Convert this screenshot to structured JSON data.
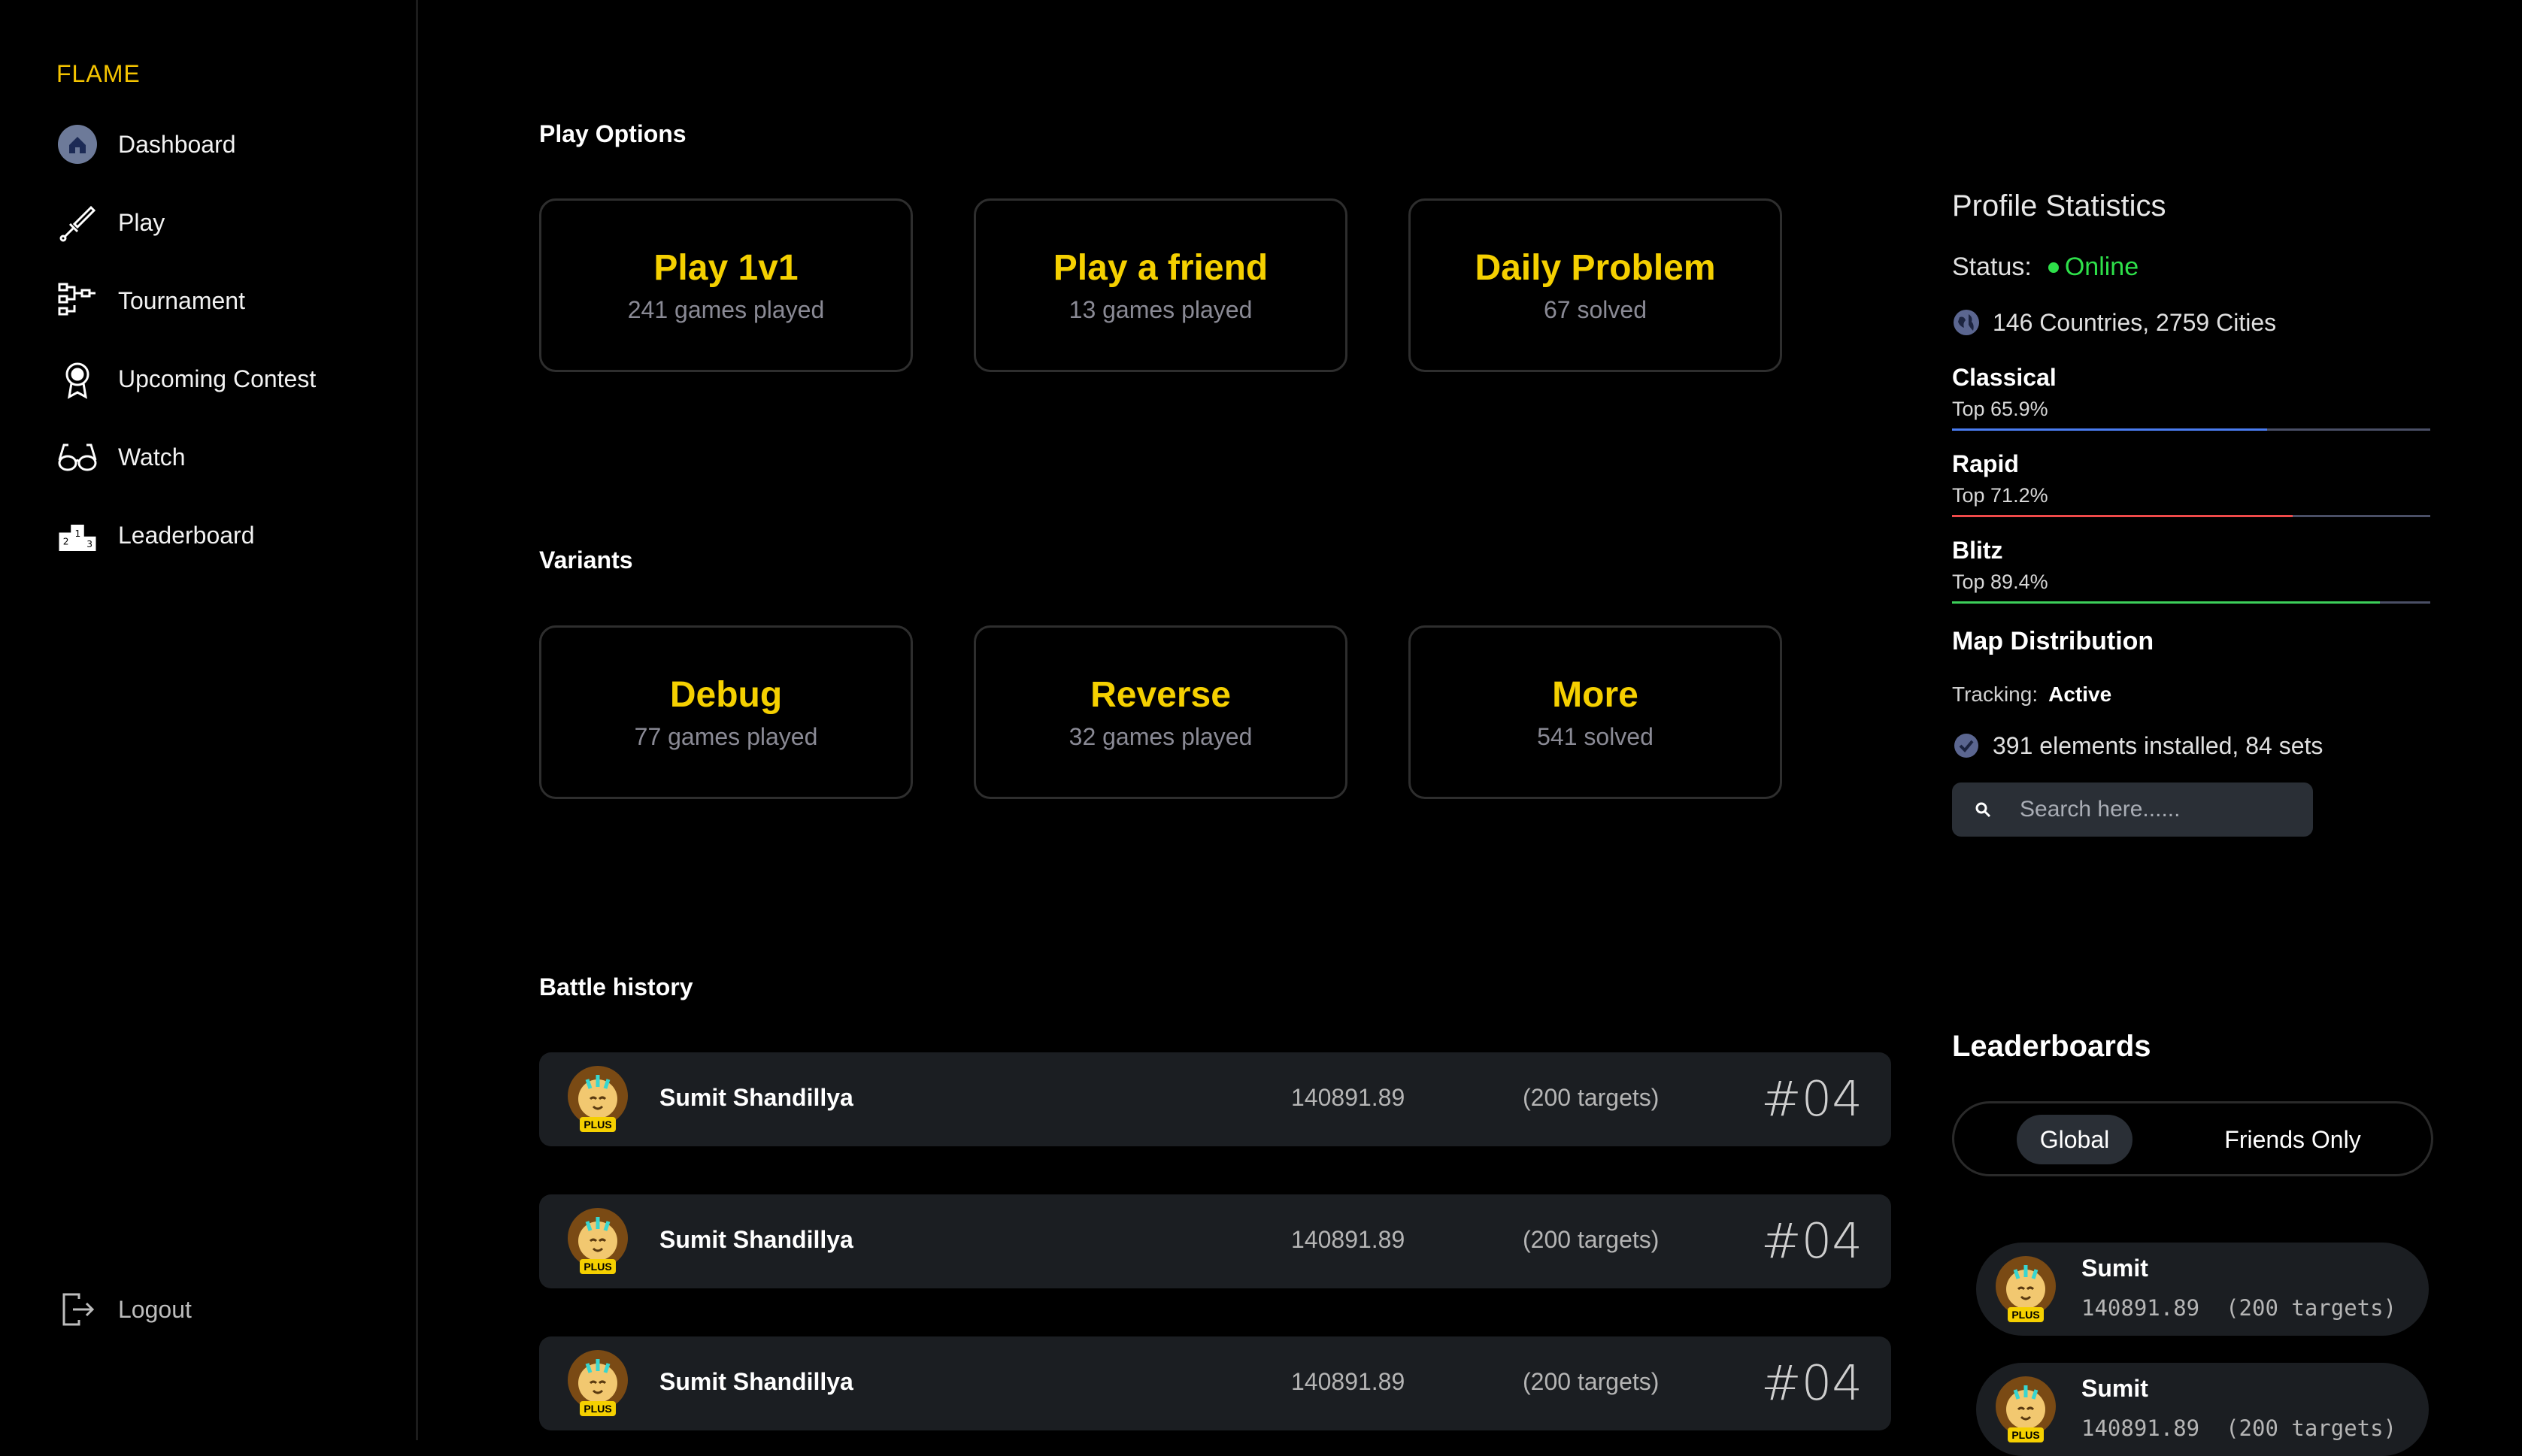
{
  "sidebar": {
    "brand": "FLAME",
    "items": [
      {
        "label": "Dashboard",
        "icon": "home-icon"
      },
      {
        "label": "Play",
        "icon": "sword-icon"
      },
      {
        "label": "Tournament",
        "icon": "bracket-icon"
      },
      {
        "label": "Upcoming Contest",
        "icon": "award-icon"
      },
      {
        "label": "Watch",
        "icon": "glasses-icon"
      },
      {
        "label": "Leaderboard",
        "icon": "podium-icon"
      }
    ],
    "logout": "Logout"
  },
  "play_options": {
    "title": "Play Options",
    "cards": [
      {
        "title": "Play 1v1",
        "sub": "241 games played"
      },
      {
        "title": "Play a friend",
        "sub": "13 games played"
      },
      {
        "title": "Daily Problem",
        "sub": "67 solved"
      }
    ]
  },
  "variants": {
    "title": "Variants",
    "cards": [
      {
        "title": "Debug",
        "sub": "77 games played"
      },
      {
        "title": "Reverse",
        "sub": "32 games played"
      },
      {
        "title": "More",
        "sub": "541 solved"
      }
    ]
  },
  "battle_history": {
    "title": "Battle history",
    "rows": [
      {
        "name": "Sumit Shandillya",
        "score": "140891.89",
        "targets": "(200 targets)",
        "rank": "#04"
      },
      {
        "name": "Sumit Shandillya",
        "score": "140891.89",
        "targets": "(200 targets)",
        "rank": "#04"
      },
      {
        "name": "Sumit Shandillya",
        "score": "140891.89",
        "targets": "(200 targets)",
        "rank": "#04"
      }
    ]
  },
  "profile": {
    "title": "Profile Statistics",
    "status_label": "Status:",
    "status_value": "Online",
    "location": "146 Countries, 2759 Cities",
    "stats": [
      {
        "name": "Classical",
        "top": "Top 65.9%",
        "fill": 0.659,
        "color": "#4a7cf0"
      },
      {
        "name": "Rapid",
        "top": "Top 71.2%",
        "fill": 0.712,
        "color": "#f04a4a"
      },
      {
        "name": "Blitz",
        "top": "Top 89.4%",
        "fill": 0.894,
        "color": "#3ccf5a"
      }
    ],
    "map_title": "Map Distribution",
    "tracking_label": "Tracking:",
    "tracking_value": "Active",
    "elements": "391 elements installed, 84 sets",
    "search_placeholder": "Search here......"
  },
  "leaderboards": {
    "title": "Leaderboards",
    "tabs": [
      "Global",
      "Friends Only"
    ],
    "active_tab": "Global",
    "entries": [
      {
        "name": "Sumit",
        "score": "140891.89",
        "targets": "(200 targets)"
      },
      {
        "name": "Sumit",
        "score": "140891.89",
        "targets": "(200 targets)"
      }
    ]
  },
  "avatar_badge": "PLUS",
  "colors": {
    "accent": "#f5d000",
    "online": "#2ee04a",
    "card_bg": "#1b1e22"
  }
}
